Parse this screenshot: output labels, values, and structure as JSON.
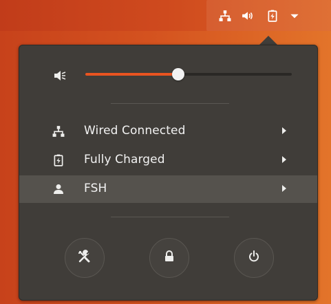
{
  "topbar": {
    "icons": [
      "network-wired-icon",
      "volume-icon",
      "battery-charging-icon",
      "dropdown-arrow-icon"
    ]
  },
  "volume": {
    "icon": "volume-muted-icon",
    "level_percent": 45
  },
  "menu": {
    "items": [
      {
        "icon": "network-wired-icon",
        "label": "Wired Connected"
      },
      {
        "icon": "battery-charging-icon",
        "label": "Fully Charged"
      },
      {
        "icon": "user-icon",
        "label": "FSH"
      }
    ]
  },
  "actions": [
    {
      "icon": "settings-tools-icon"
    },
    {
      "icon": "lock-icon"
    },
    {
      "icon": "power-icon"
    }
  ],
  "colors": {
    "accent": "#e95420",
    "panel_bg": "#403d39",
    "hover_bg": "#55524d"
  }
}
